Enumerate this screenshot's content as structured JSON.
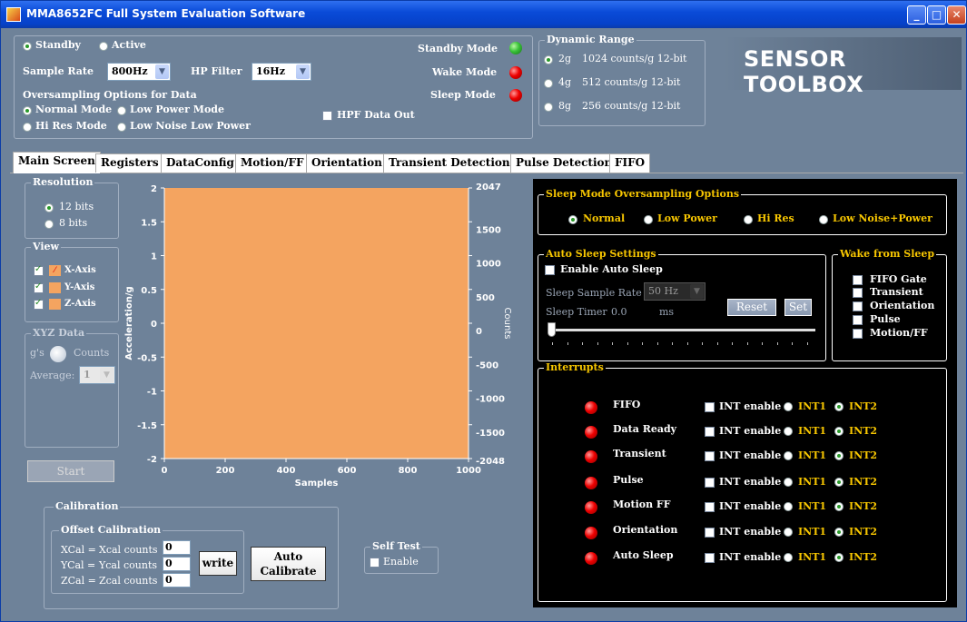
{
  "window": {
    "title": "MMA8652FC Full System Evaluation Software"
  },
  "header": {
    "standby": "Standby",
    "active": "Active",
    "sample_rate_label": "Sample Rate",
    "sample_rate": "800Hz",
    "hp_filter_label": "HP Filter",
    "hp_filter": "16Hz",
    "oversampling_label": "Oversampling Options for Data",
    "os": [
      "Normal Mode",
      "Low Power Mode",
      "Hi Res Mode",
      "Low Noise Low Power"
    ],
    "hpf_out": "HPF Data Out",
    "modes": [
      "Standby Mode",
      "Wake Mode",
      "Sleep Mode"
    ],
    "dynamic_range_title": "Dynamic Range",
    "ranges": [
      {
        "g": "2g",
        "desc": "1024 counts/g 12-bit"
      },
      {
        "g": "4g",
        "desc": "512 counts/g 12-bit"
      },
      {
        "g": "8g",
        "desc": "256 counts/g 12-bit"
      }
    ],
    "logo": "SENSOR TOOLBOX"
  },
  "tabs": [
    "Main Screen",
    "Registers",
    "DataConfig",
    "Motion/FF",
    "Orientation",
    "Transient Detection",
    "Pulse Detection",
    "FIFO"
  ],
  "left": {
    "resolution_title": "Resolution",
    "res": [
      "12 bits",
      "8 bits"
    ],
    "view_title": "View",
    "axes": [
      "X-Axis",
      "Y-Axis",
      "Z-Axis"
    ],
    "xyz_title": "XYZ Data",
    "gs": "g's",
    "counts": "Counts",
    "average_label": "Average:",
    "average": "1",
    "start": "Start"
  },
  "chart_data": {
    "type": "line",
    "xlabel": "Samples",
    "ylabel": "Acceleration/g",
    "y2label": "Counts",
    "xlim": [
      0,
      1000
    ],
    "ylim": [
      -2,
      2
    ],
    "y2lim": [
      -2048,
      2047
    ],
    "xticks": [
      "0",
      "200",
      "400",
      "600",
      "800",
      "1000"
    ],
    "yticks": [
      "2",
      "1.5",
      "1",
      "0.5",
      "0",
      "-0.5",
      "-1",
      "-1.5",
      "-2"
    ],
    "y2ticks": [
      "2047",
      "1500",
      "1000",
      "500",
      "0",
      "-500",
      "-1000",
      "-1500",
      "-2048"
    ],
    "series": [],
    "plot_bg": "#f4a460"
  },
  "calib": {
    "title": "Calibration",
    "offset_title": "Offset Calibration",
    "rows": [
      {
        "l": "XCal =",
        "m": "Xcal counts",
        "v": "0"
      },
      {
        "l": "YCal =",
        "m": "Ycal counts",
        "v": "0"
      },
      {
        "l": "ZCal =",
        "m": "Zcal counts",
        "v": "0"
      }
    ],
    "write": "write",
    "auto": "Auto Calibrate"
  },
  "selftest": {
    "title": "Self Test",
    "enable": "Enable"
  },
  "sleep_os": {
    "title": "Sleep Mode Oversampling Options",
    "opts": [
      "Normal",
      "Low Power",
      "Hi Res",
      "Low Noise+Power"
    ]
  },
  "autosleep": {
    "title": "Auto Sleep Settings",
    "enable": "Enable Auto Sleep",
    "rate_label": "Sleep Sample Rate",
    "rate": "50 Hz",
    "timer_label": "Sleep Timer",
    "timer": "0.0",
    "unit": "ms",
    "reset": "Reset",
    "set": "Set"
  },
  "wake": {
    "title": "Wake from Sleep",
    "items": [
      "FIFO Gate",
      "Transient",
      "Orientation",
      "Pulse",
      "Motion/FF"
    ]
  },
  "interrupts": {
    "title": "Interrupts",
    "enable": "INT enable",
    "int1": "INT1",
    "int2": "INT2",
    "rows": [
      "FIFO",
      "Data Ready",
      "Transient",
      "Pulse",
      "Motion FF",
      "Orientation",
      "Auto Sleep"
    ]
  },
  "colors": {
    "panel": "#6e8299",
    "dark_panel": "#000000",
    "accent": "#f7c600",
    "led_red": "#e00000",
    "led_green": "#38c238"
  }
}
